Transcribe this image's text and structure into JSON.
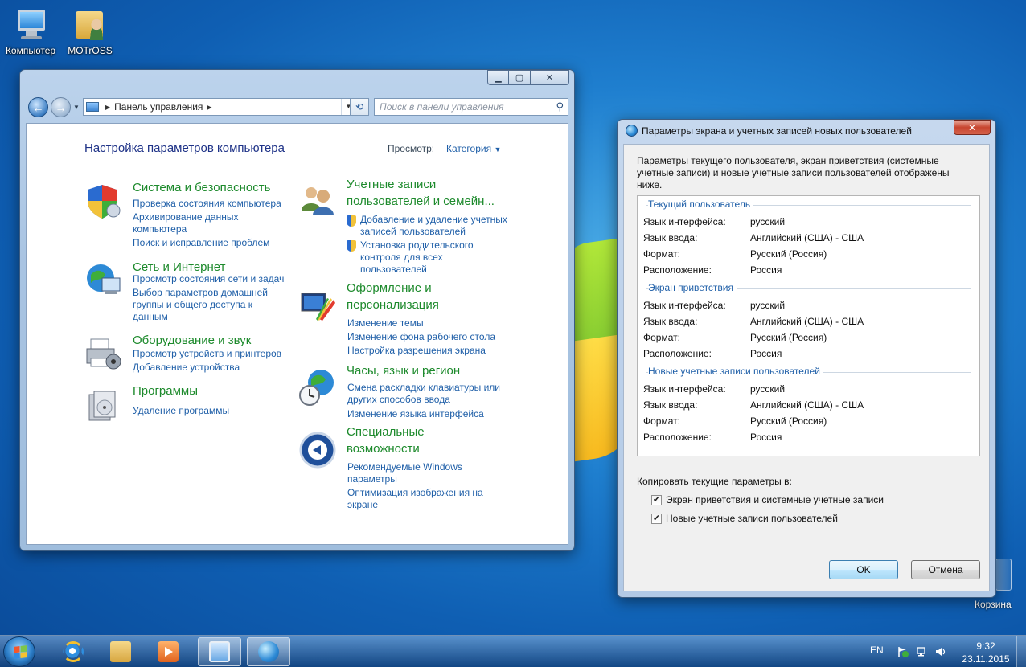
{
  "desktop": {
    "icons": [
      {
        "label": "Компьютер"
      },
      {
        "label": "MOTrOSS"
      }
    ],
    "recycle_bin": "Корзина"
  },
  "control_panel": {
    "address_crumb": "Панель управления",
    "search_placeholder": "Поиск в панели управления",
    "heading": "Настройка параметров компьютера",
    "view_by_label": "Просмотр:",
    "view_by_value": "Категория",
    "categories_left": [
      {
        "title": "Система и безопасность",
        "links": [
          "Проверка состояния компьютера",
          "Архивирование данных\nкомпьютера",
          "Поиск и исправление проблем"
        ]
      },
      {
        "title": "Сеть и Интернет",
        "links": [
          "Просмотр состояния сети и задач",
          "Выбор параметров домашней\nгруппы и общего доступа к\nданным"
        ]
      },
      {
        "title": "Оборудование и звук",
        "links": [
          "Просмотр устройств и принтеров",
          "Добавление устройства"
        ]
      },
      {
        "title": "Программы",
        "links": [
          "Удаление программы"
        ]
      }
    ],
    "categories_right": [
      {
        "title": "Учетные записи\nпользователей и семейн...",
        "links": [
          "Добавление и удаление учетных\nзаписей пользователей",
          "Установка родительского\nконтроля для всех\nпользователей"
        ]
      },
      {
        "title": "Оформление и\nперсонализация",
        "links": [
          "Изменение темы",
          "Изменение фона рабочего стола",
          "Настройка разрешения экрана"
        ]
      },
      {
        "title": "Часы, язык и регион",
        "links": [
          "Смена раскладки клавиатуры или\nдругих способов ввода",
          "Изменение языка интерфейса"
        ]
      },
      {
        "title": "Специальные\nвозможности",
        "links": [
          "Рекомендуемые Windows\nпараметры",
          "Оптимизация изображения на\nэкране"
        ]
      }
    ]
  },
  "dialog": {
    "title": "Параметры экрана и учетных записей новых пользователей",
    "intro": "Параметры текущего пользователя, экран приветствия (системные учетные записи) и новые учетные записи пользователей отображены ниже.",
    "sections": [
      {
        "heading": "Текущий пользователь",
        "rows": [
          {
            "label": "Язык интерфейса:",
            "value": "русский"
          },
          {
            "label": "Язык ввода:",
            "value": "Английский (США) - США"
          },
          {
            "label": "Формат:",
            "value": "Русский (Россия)"
          },
          {
            "label": "Расположение:",
            "value": "Россия"
          }
        ]
      },
      {
        "heading": "Экран приветствия",
        "rows": [
          {
            "label": "Язык интерфейса:",
            "value": "русский"
          },
          {
            "label": "Язык ввода:",
            "value": "Английский (США) - США"
          },
          {
            "label": "Формат:",
            "value": "Русский (Россия)"
          },
          {
            "label": "Расположение:",
            "value": "Россия"
          }
        ]
      },
      {
        "heading": "Новые учетные записи пользователей",
        "rows": [
          {
            "label": "Язык интерфейса:",
            "value": "русский"
          },
          {
            "label": "Язык ввода:",
            "value": "Английский (США) - США"
          },
          {
            "label": "Формат:",
            "value": "Русский (Россия)"
          },
          {
            "label": "Расположение:",
            "value": "Россия"
          }
        ]
      }
    ],
    "copy_label": "Копировать текущие параметры в:",
    "checkboxes": [
      {
        "label": "Экран приветствия и системные учетные записи",
        "checked": true
      },
      {
        "label": "Новые учетные записи пользователей",
        "checked": true
      }
    ],
    "ok_label": "OK",
    "cancel_label": "Отмена"
  },
  "taskbar": {
    "language": "EN",
    "time": "9:32",
    "date": "23.11.2015"
  }
}
